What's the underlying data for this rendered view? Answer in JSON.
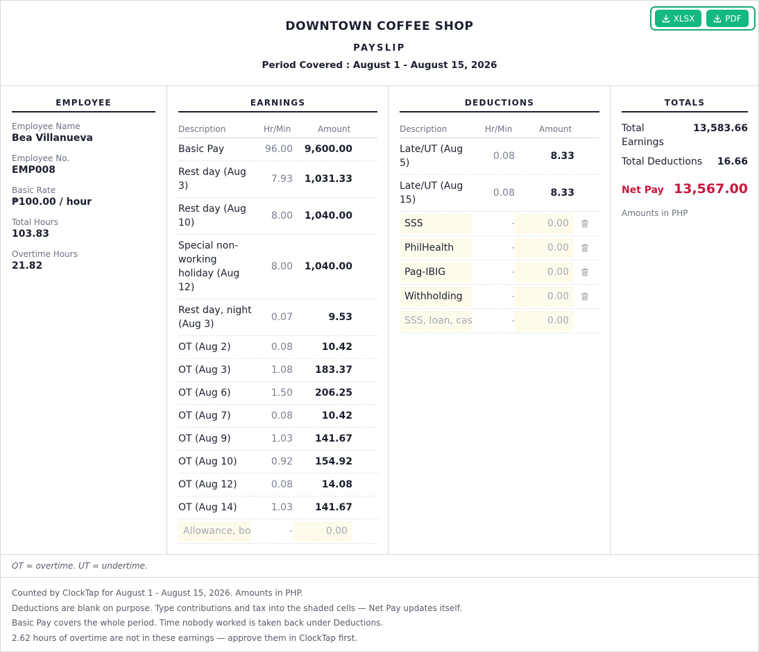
{
  "header": {
    "company": "DOWNTOWN COFFEE SHOP",
    "doc_type": "PAYSLIP",
    "period": "Period Covered : August 1 - August 15, 2026",
    "export": {
      "xlsx_label": "XLSX",
      "pdf_label": "PDF"
    }
  },
  "employee": {
    "heading": "EMPLOYEE",
    "fields": [
      {
        "label": "Employee Name",
        "value": "Bea Villanueva"
      },
      {
        "label": "Employee No.",
        "value": "EMP008"
      },
      {
        "label": "Basic Rate",
        "value": "₱100.00 / hour"
      },
      {
        "label": "Total Hours",
        "value": "103.83"
      },
      {
        "label": "Overtime Hours",
        "value": "21.82"
      }
    ]
  },
  "earnings": {
    "heading": "EARNINGS",
    "columns": {
      "description": "Description",
      "hours": "Hr/Min",
      "amount": "Amount"
    },
    "rows": [
      {
        "description": "Basic Pay",
        "hours": "96.00",
        "amount": "9,600.00"
      },
      {
        "description": "Rest day (Aug 3)",
        "hours": "7.93",
        "amount": "1,031.33"
      },
      {
        "description": "Rest day (Aug 10)",
        "hours": "8.00",
        "amount": "1,040.00"
      },
      {
        "description": "Special non-working holiday (Aug 12)",
        "hours": "8.00",
        "amount": "1,040.00"
      },
      {
        "description": "Rest day, night (Aug 3)",
        "hours": "0.07",
        "amount": "9.53"
      },
      {
        "description": "OT (Aug 2)",
        "hours": "0.08",
        "amount": "10.42"
      },
      {
        "description": "OT (Aug 3)",
        "hours": "1.08",
        "amount": "183.37"
      },
      {
        "description": "OT (Aug 6)",
        "hours": "1.50",
        "amount": "206.25"
      },
      {
        "description": "OT (Aug 7)",
        "hours": "0.08",
        "amount": "10.42"
      },
      {
        "description": "OT (Aug 9)",
        "hours": "1.03",
        "amount": "141.67"
      },
      {
        "description": "OT (Aug 10)",
        "hours": "0.92",
        "amount": "154.92"
      },
      {
        "description": "OT (Aug 12)",
        "hours": "0.08",
        "amount": "14.08"
      },
      {
        "description": "OT (Aug 14)",
        "hours": "1.03",
        "amount": "141.67"
      }
    ],
    "new_row": {
      "placeholder": "Allowance, bonus",
      "hours": "-",
      "amount": "0.00"
    }
  },
  "deductions": {
    "heading": "DEDUCTIONS",
    "columns": {
      "description": "Description",
      "hours": "Hr/Min",
      "amount": "Amount"
    },
    "rows": [
      {
        "description": "Late/UT (Aug 5)",
        "hours": "0.08",
        "amount": "8.33"
      },
      {
        "description": "Late/UT (Aug 15)",
        "hours": "0.08",
        "amount": "8.33"
      }
    ],
    "editable_rows": [
      {
        "description": "SSS",
        "hours": "-",
        "amount": "0.00"
      },
      {
        "description": "PhilHealth",
        "hours": "-",
        "amount": "0.00"
      },
      {
        "description": "Pag-IBIG",
        "hours": "-",
        "amount": "0.00"
      },
      {
        "description": "Withholding",
        "hours": "-",
        "amount": "0.00"
      }
    ],
    "new_row": {
      "placeholder": "SSS, loan, cash advance",
      "hours": "-",
      "amount": "0.00"
    }
  },
  "totals": {
    "heading": "TOTALS",
    "total_earnings_label": "Total Earnings",
    "total_earnings": "13,583.66",
    "total_deductions_label": "Total Deductions",
    "total_deductions": "16.66",
    "net_pay_label": "Net Pay",
    "net_pay": "13,567.00",
    "note": "Amounts in PHP"
  },
  "legend": "OT = overtime. UT = undertime.",
  "notes": [
    "Counted by ClockTap for August 1 - August 15, 2026. Amounts in PHP.",
    "Deductions are blank on purpose. Type contributions and tax into the shaded cells — Net Pay updates itself.",
    "Basic Pay covers the whole period. Time nobody worked is taken back under Deductions.",
    "2.62 hours of overtime are not in these earnings — approve them in ClockTap first."
  ],
  "colors": {
    "accent": "#12b981",
    "net_pay": "#c8173d",
    "shaded_cell": "#fefbea"
  },
  "icons": {
    "export": "download-icon",
    "delete": "trash-icon"
  }
}
